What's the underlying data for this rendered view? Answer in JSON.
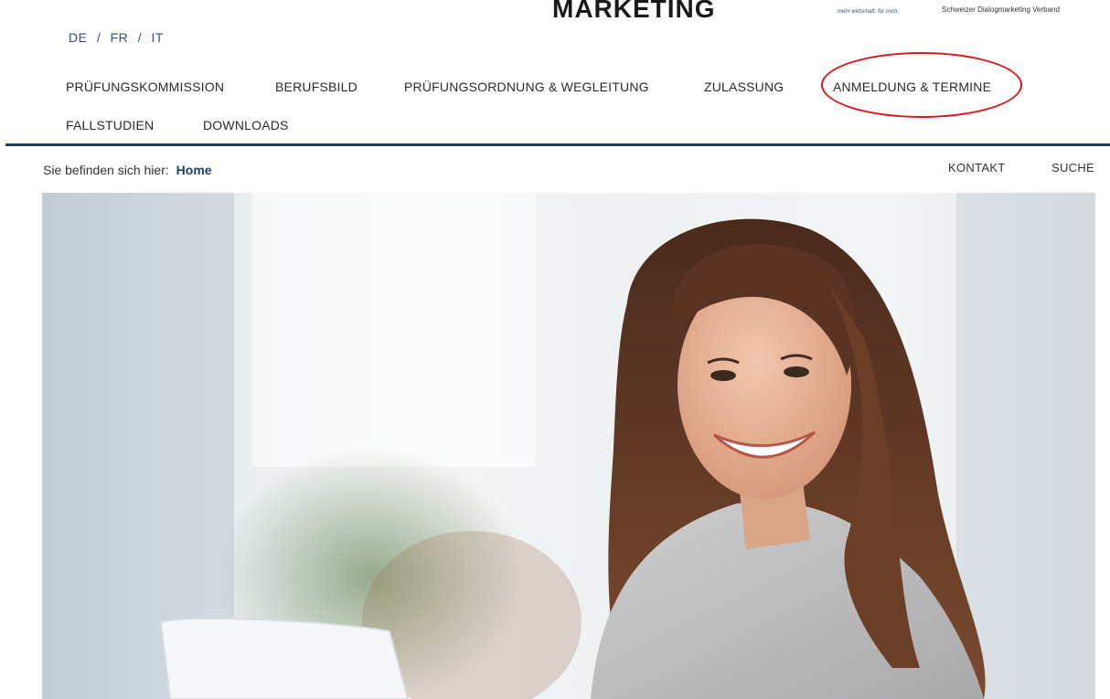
{
  "header": {
    "logo_text": "MARKETING",
    "tagline_left": "mehr wirtschaft. für mich.",
    "tagline_right": "Schweizer Dialogmarketing Verband"
  },
  "languages": [
    "DE",
    "FR",
    "IT"
  ],
  "lang_separator": "/",
  "nav": {
    "items": [
      {
        "label": "PRÜFUNGSKOMMISSION"
      },
      {
        "label": "BERUFSBILD"
      },
      {
        "label": "PRÜFUNGSORDNUNG & WEGLEITUNG"
      },
      {
        "label": "ZULASSUNG"
      },
      {
        "label": "ANMELDUNG & TERMINE"
      },
      {
        "label": "FALLSTUDIEN"
      },
      {
        "label": "DOWNLOADS"
      }
    ]
  },
  "breadcrumb": {
    "prefix": "Sie befinden sich hier:",
    "current": "Home"
  },
  "utility": {
    "contact": "KONTAKT",
    "search": "SUCHE"
  },
  "colors": {
    "accent": "#1d3f6e",
    "highlight": "#e01515"
  }
}
